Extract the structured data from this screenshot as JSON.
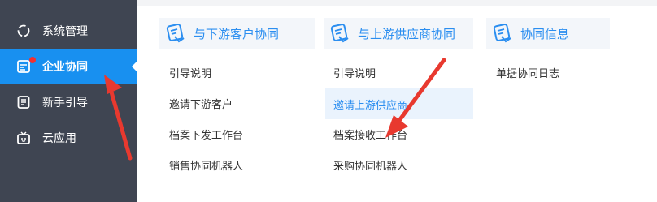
{
  "sidebar": {
    "items": [
      {
        "label": "系统管理",
        "icon": "sync-circle-icon"
      },
      {
        "label": "企业协同",
        "icon": "collab-doc-icon",
        "active": true,
        "badge": "red-dot"
      },
      {
        "label": "新手引导",
        "icon": "guide-book-icon"
      },
      {
        "label": "云应用",
        "icon": "tv-app-icon"
      }
    ]
  },
  "columns": [
    {
      "title": "与下游客户协同",
      "icon": "handshake-doc-icon",
      "items": [
        "引导说明",
        "邀请下游客户",
        "档案下发工作台",
        "销售协同机器人"
      ]
    },
    {
      "title": "与上游供应商协同",
      "icon": "handshake-doc-icon",
      "items": [
        "引导说明",
        "邀请上游供应商",
        "档案接收工作台",
        "采购协同机器人"
      ],
      "highlighted_index": 1
    },
    {
      "title": "协同信息",
      "icon": "handshake-doc-icon",
      "items": [
        "单据协同日志"
      ]
    }
  ],
  "colors": {
    "sidebar_bg": "#3f4552",
    "active_bg": "#1890f0",
    "accent": "#2b8ef0",
    "annotation_arrow": "#e8392f"
  }
}
